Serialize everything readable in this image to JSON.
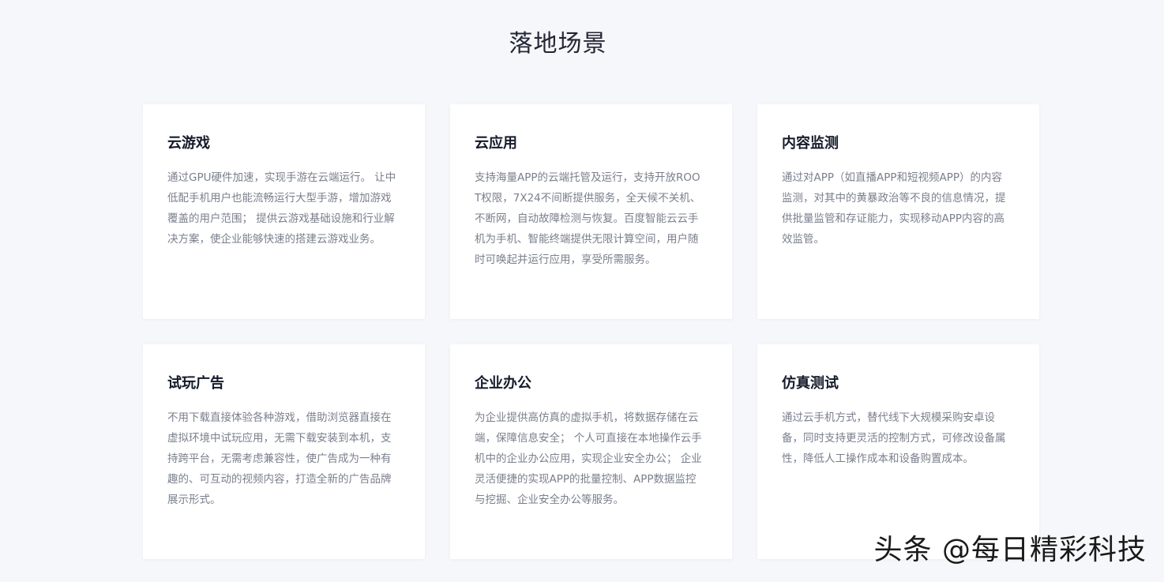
{
  "section": {
    "title": "落地场景"
  },
  "cards": [
    {
      "title": "云游戏",
      "desc": "通过GPU硬件加速，实现手游在云端运行。 让中低配手机用户也能流畅运行大型手游，增加游戏覆盖的用户范围； 提供云游戏基础设施和行业解决方案，使企业能够快速的搭建云游戏业务。"
    },
    {
      "title": "云应用",
      "desc": "支持海量APP的云端托管及运行，支持开放ROOT权限，7X24不间断提供服务，全天候不关机、不断网，自动故障检测与恢复。百度智能云云手机为手机、智能终端提供无限计算空间，用户随时可唤起并运行应用，享受所需服务。"
    },
    {
      "title": "内容监测",
      "desc": "通过对APP（如直播APP和短视频APP）的内容监测，对其中的黄暴政治等不良的信息情况，提供批量监管和存证能力，实现移动APP内容的高效监管。"
    },
    {
      "title": "试玩广告",
      "desc": "不用下载直接体验各种游戏，借助浏览器直接在虚拟环境中试玩应用，无需下载安装到本机，支持跨平台，无需考虑兼容性，使广告成为一种有趣的、可互动的视频内容，打造全新的广告品牌展示形式。"
    },
    {
      "title": "企业办公",
      "desc": "为企业提供高仿真的虚拟手机，将数据存储在云端，保障信息安全； 个人可直接在本地操作云手机中的企业办公应用，实现企业安全办公； 企业灵活便捷的实现APP的批量控制、APP数据监控与挖掘、企业安全办公等服务。"
    },
    {
      "title": "仿真测试",
      "desc": "通过云手机方式，替代线下大规模采购安卓设备，同时支持更灵活的控制方式，可修改设备属性，降低人工操作成本和设备购置成本。"
    }
  ],
  "watermark": {
    "text": "头条 @每日精彩科技"
  }
}
